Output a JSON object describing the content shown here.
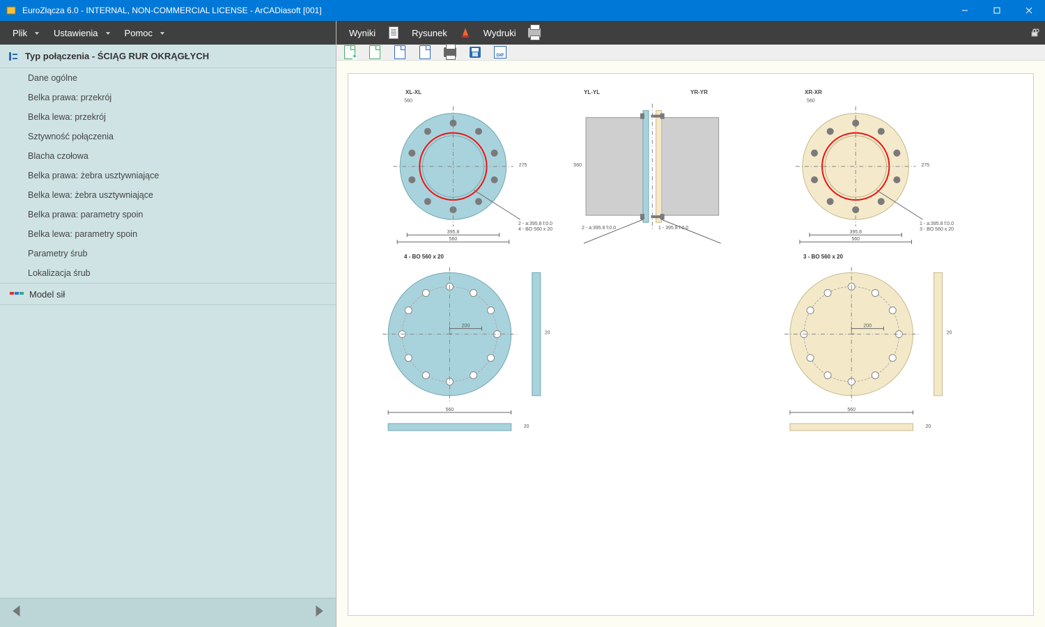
{
  "window": {
    "title": "EuroZłącza 6.0 - INTERNAL, NON-COMMERCIAL LICENSE - ArCADiasoft [001]"
  },
  "left_menu": {
    "items": [
      {
        "label": "Plik",
        "has_dropdown": true
      },
      {
        "label": "Ustawienia",
        "has_dropdown": true
      },
      {
        "label": "Pomoc",
        "has_dropdown": true
      }
    ]
  },
  "right_menu": {
    "items": [
      {
        "label": "Wyniki"
      },
      {
        "label": "Rysunek"
      },
      {
        "label": "Wydruki"
      }
    ]
  },
  "nav": {
    "header": "Typ połączenia - ŚCIĄG RUR OKRĄGŁYCH",
    "items": [
      "Dane ogólne",
      "Belka prawa: przekrój",
      "Belka lewa: przekrój",
      "Sztywność połączenia",
      "Blacha czołowa",
      "Belka prawa: żebra usztywniające",
      "Belka lewa: żebra usztywniające",
      "Belka prawa: parametry spoin",
      "Belka lewa: parametry spoin",
      "Parametry śrub",
      "Lokalizacja śrub"
    ],
    "section": "Model sił"
  },
  "toolbar": {
    "buttons": [
      "new-page",
      "page",
      "zoom-page",
      "magnify-page",
      "print",
      "save",
      "dxf"
    ]
  },
  "drawing": {
    "views": {
      "top_left": {
        "label": "XL-XL",
        "plate_hint_top": "560",
        "plate_hint_right": "275",
        "dim_bottom_a": "395.8",
        "dim_bottom_b": "560",
        "leader_a": "2 - a:395.8 f:0.0",
        "leader_b": "4 - BO 560 x 20"
      },
      "top_mid": {
        "label_left": "YL-YL",
        "label_right": "YR-YR",
        "dim_left": "560",
        "leader_a": "2 - a:395.8 f:0.0",
        "leader_b": "1 - 395.8 f:0.0"
      },
      "top_right": {
        "label": "XR-XR",
        "plate_hint_top": "560",
        "plate_hint_right": "275",
        "dim_bottom_a": "395.8",
        "dim_bottom_b": "560",
        "leader_a": "1 - a:395.8 f:0.0",
        "leader_b": "3 - BO 560 x 20"
      },
      "bot_left": {
        "title": "4 - BO 560 x 20",
        "hole_dim": "200",
        "width": "560",
        "thk": "20"
      },
      "bot_right": {
        "title": "3 - BO 560 x 20",
        "hole_dim": "200",
        "width": "560",
        "thk": "20"
      }
    }
  },
  "colors": {
    "left_flange": "#a9d3dc",
    "left_plate": "#a9d3dc",
    "weld_ring": "#e11",
    "right_flange": "#f4eacb",
    "right_plate": "#f3e9c9",
    "tube": "#cfcfcf",
    "bolt": "#7a7a7a"
  }
}
